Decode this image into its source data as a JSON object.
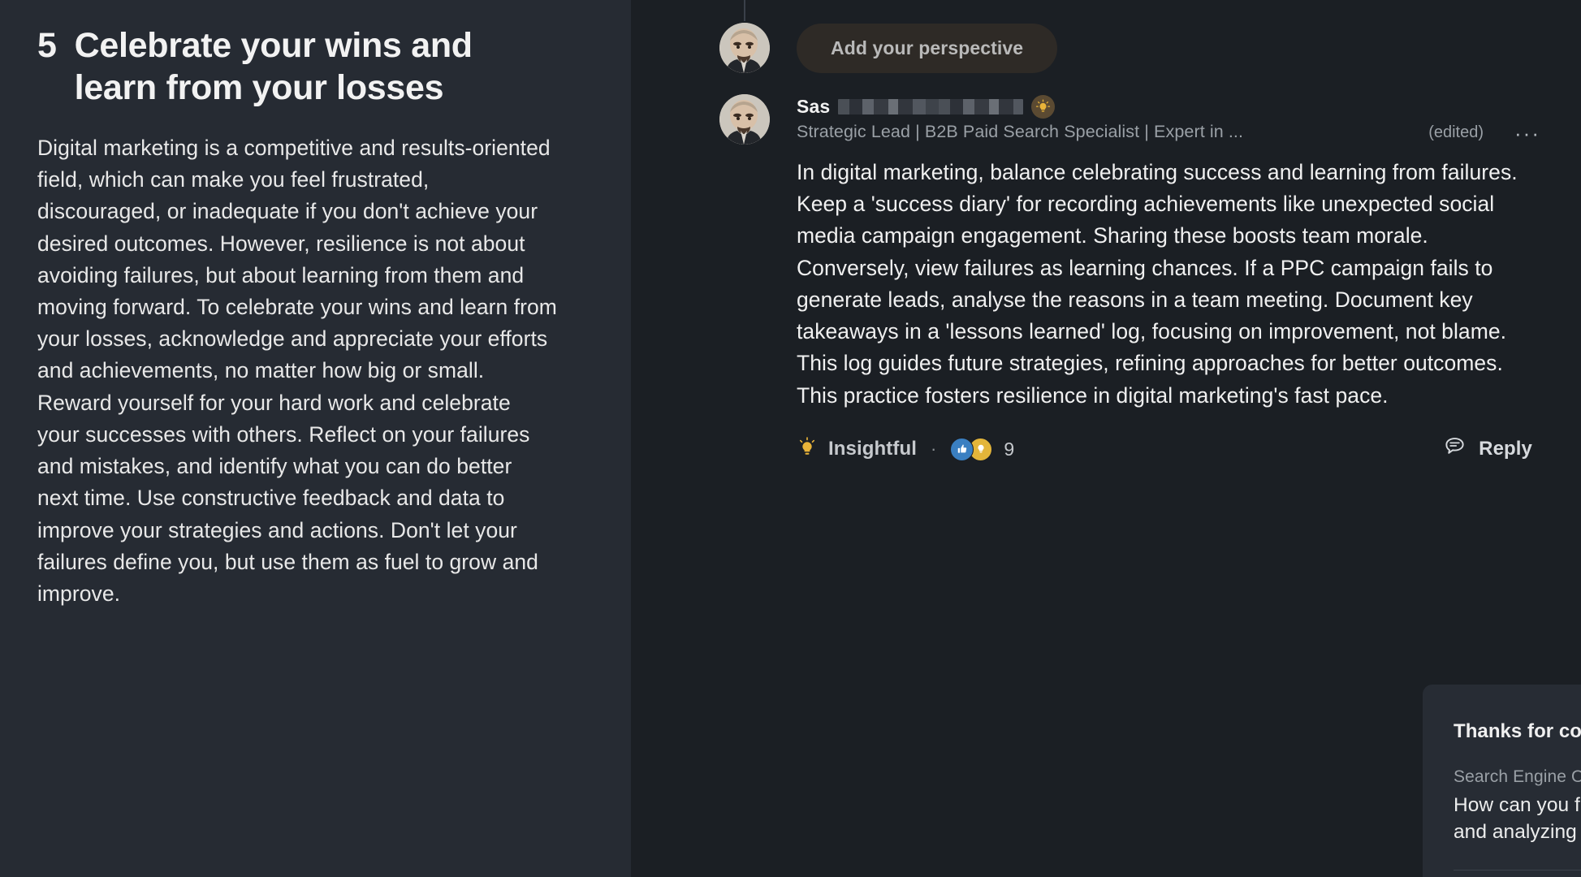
{
  "article": {
    "number": "5",
    "title": "Celebrate your wins and learn from your losses",
    "body": "Digital marketing is a competitive and results-oriented field, which can make you feel frustrated, discouraged, or inadequate if you don't achieve your desired outcomes. However, resilience is not about avoiding failures, but about learning from them and moving forward. To celebrate your wins and learn from your losses, acknowledge and appreciate your efforts and achievements, no matter how big or small. Reward yourself for your hard work and celebrate your successes with others. Reflect on your failures and mistakes, and identify what you can do better next time. Use constructive feedback and data to improve your strategies and actions. Don't let your failures define you, but use them as fuel to grow and improve."
  },
  "perspective": {
    "button_label": "Add your perspective"
  },
  "comment": {
    "author_name": "Sas",
    "author_name_redacted": true,
    "badge_icon": "lightbulb-badge-icon",
    "author_subtitle": "Strategic Lead | B2B Paid Search Specialist | Expert in ...",
    "edited_label": "(edited)",
    "more_label": "···",
    "body": "In digital marketing, balance celebrating success and learning from failures. Keep a 'success diary' for recording achievements like unexpected social media campaign engagement. Sharing these boosts team morale. Conversely, view failures as learning chances. If a PPC campaign fails to generate leads, analyse the reasons in a team meeting. Document key takeaways in a 'lessons learned' log, focusing on improvement, not blame. This log guides future strategies, refining approaches for better outcomes. This practice fosters resilience in digital marketing's fast pace.",
    "actions": {
      "insightful_label": "Insightful",
      "separator": "·",
      "reaction_count": "9",
      "reply_label": "Reply"
    }
  },
  "thanks_card": {
    "title": "Thanks for contributing! Add to more articles:",
    "suggestion_category": "Search Engine Optimization",
    "suggestion_question": "How can you find the most reliable SEO tools for monitoring website traffic and analyzing user behavior?"
  },
  "colors": {
    "left_panel_bg": "#262b33",
    "right_panel_bg": "#1b1f24",
    "card_bg": "#272c34",
    "perspective_btn_bg": "#2e2a26",
    "badge_bg": "#5b4a32",
    "bulb_yellow": "#e8b339",
    "thumb_blue": "#3a7fc1",
    "muted_text": "#9aa0a6",
    "primary_text": "#f0f0f0"
  }
}
